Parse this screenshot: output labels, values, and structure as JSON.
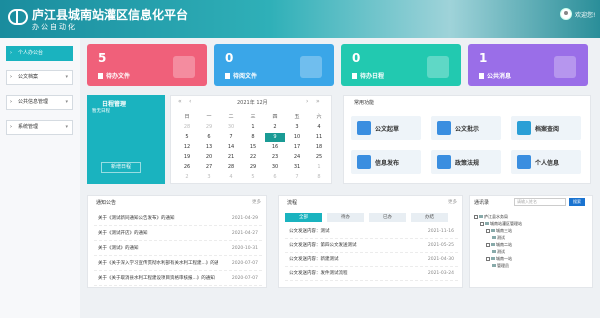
{
  "header": {
    "title": "庐江县城南站灌区信息化平台",
    "subtitle": "办公自动化",
    "welcome": "欢迎您!"
  },
  "sidebar": {
    "items": [
      {
        "label": "个人办公台",
        "active": true
      },
      {
        "label": "公文档案"
      },
      {
        "label": "公共信息管理"
      },
      {
        "label": "系统管理"
      }
    ]
  },
  "cards": [
    {
      "num": "5",
      "label": "待办文件",
      "color": "#f0607a"
    },
    {
      "num": "0",
      "label": "待阅文件",
      "color": "#3aa6e8"
    },
    {
      "num": "0",
      "label": "待办日程",
      "color": "#22c9b0"
    },
    {
      "num": "1",
      "label": "公共消息",
      "color": "#9a6ee8"
    }
  ],
  "schedule": {
    "title": "日程管理",
    "sub": "暂无日程",
    "button": "新增日程"
  },
  "calendar": {
    "month_label": "2021年 12月",
    "weekdays": [
      "日",
      "一",
      "二",
      "三",
      "四",
      "五",
      "六"
    ],
    "weeks": [
      [
        "28",
        "29",
        "30",
        "1",
        "2",
        "3",
        "4"
      ],
      [
        "5",
        "6",
        "7",
        "8",
        "9",
        "10",
        "11"
      ],
      [
        "12",
        "13",
        "14",
        "15",
        "16",
        "17",
        "18"
      ],
      [
        "19",
        "20",
        "21",
        "22",
        "23",
        "24",
        "25"
      ],
      [
        "26",
        "27",
        "28",
        "29",
        "30",
        "31",
        "1"
      ],
      [
        "2",
        "3",
        "4",
        "5",
        "6",
        "7",
        "8"
      ]
    ],
    "selected": "9"
  },
  "common": {
    "title": "常用功能",
    "items": [
      {
        "label": "公文起草",
        "icon": "document-pen-icon",
        "color": "#3a8ee0"
      },
      {
        "label": "公文批示",
        "icon": "approve-icon",
        "color": "#3a8ee0"
      },
      {
        "label": "档案查阅",
        "icon": "archive-icon",
        "color": "#2a9fd6"
      },
      {
        "label": "信息发布",
        "icon": "publish-icon",
        "color": "#3a8ee0"
      },
      {
        "label": "政策法规",
        "icon": "book-icon",
        "color": "#3a8ee0"
      },
      {
        "label": "个人信息",
        "icon": "user-icon",
        "color": "#3a8ee0"
      }
    ]
  },
  "notice": {
    "title": "通知公告",
    "more": "更多",
    "rows": [
      {
        "text": "关于《测试新同通知公告发布》的通知",
        "date": "2021-04-29"
      },
      {
        "text": "关于《测试开店》的通知",
        "date": "2021-04-27"
      },
      {
        "text": "关于《测试》的通知",
        "date": "2020-10-31"
      },
      {
        "text": "关于《关于深入学习宣传贯彻水利部有关水利工程建...》的通知",
        "date": "2020-07-07"
      },
      {
        "text": "关于《关于取消县水利工程建设项目资格审核报...》的通知",
        "date": "2020-07-07"
      }
    ]
  },
  "flow": {
    "title": "流程",
    "more": "更多",
    "tabs": [
      "全部",
      "待办",
      "已办",
      "办结"
    ],
    "rows": [
      {
        "text": "公文发送内容：测试",
        "date": "2021-11-16"
      },
      {
        "text": "公文发送内容：第四公文发送测试",
        "date": "2021-05-25"
      },
      {
        "text": "公文发送内容：新建测试",
        "date": "2021-04-30"
      },
      {
        "text": "公文发送内容：发件测试流程",
        "date": "2021-03-24"
      }
    ]
  },
  "contact": {
    "title": "通讯录",
    "placeholder": "请输入姓名",
    "search": "搜索",
    "tree": [
      "庐江县水务局",
      "城南站灌区管理站",
      "城南三站",
      "测试",
      "城南二站",
      "测试",
      "城南一站",
      "管理员"
    ]
  }
}
